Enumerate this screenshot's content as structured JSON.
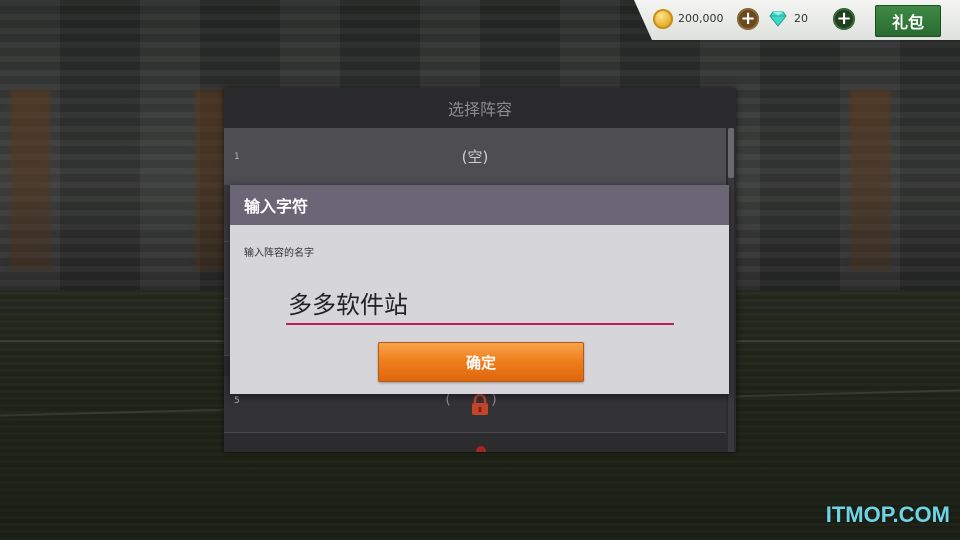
{
  "currency": {
    "coins_icon": "gold-coin-icon",
    "coins": "200,000",
    "gems_icon": "diamond-icon",
    "gems": "20",
    "gift_label": "礼包"
  },
  "lineup": {
    "title": "选择阵容",
    "rows": [
      {
        "num": "1",
        "label": "(空)"
      },
      {
        "num": "",
        "label": ""
      },
      {
        "num": "",
        "label": ""
      },
      {
        "num": "",
        "label": ""
      },
      {
        "num": "5",
        "label": "( )"
      }
    ]
  },
  "dialog": {
    "title": "输入字符",
    "hint": "输入阵容的名字",
    "input_value": "多多软件站",
    "confirm_label": "确定",
    "accent_color": "#c41e5a",
    "button_color": "#ee7d1a"
  },
  "watermark": "ITMOP.COM"
}
